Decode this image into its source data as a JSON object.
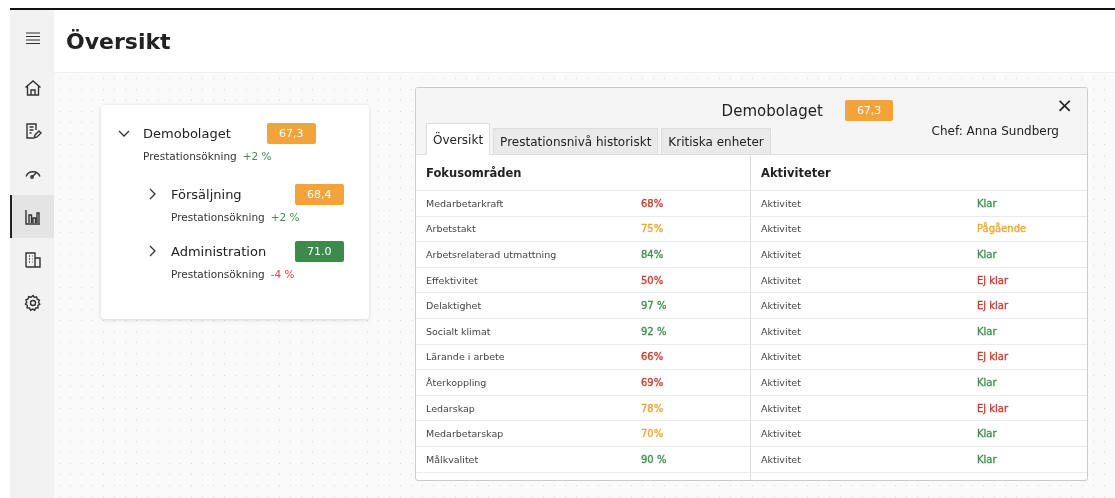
{
  "sidebar": {
    "items": [
      {
        "kind": "menu",
        "selected": false
      },
      {
        "kind": "home",
        "selected": false
      },
      {
        "kind": "report",
        "selected": false
      },
      {
        "kind": "gauge",
        "selected": false
      },
      {
        "kind": "chart",
        "selected": true
      },
      {
        "kind": "building",
        "selected": false
      },
      {
        "kind": "settings",
        "selected": false
      }
    ]
  },
  "page_title": "Översikt",
  "tree": [
    {
      "name": "Demobolaget",
      "score": {
        "text": "67,3",
        "color": "#f2a43a"
      },
      "metric": "Prestationsökning",
      "change": {
        "text": "+2 %",
        "color": "#3f8f4f"
      },
      "expanded": true,
      "children": [
        {
          "name": "Försäljning",
          "score": {
            "text": "68,4",
            "color": "#f2a43a"
          },
          "metric": "Prestationsökning",
          "change": {
            "text": "+2 %",
            "color": "#3f8f4f"
          },
          "expanded": false
        },
        {
          "name": "Administration",
          "score": {
            "text": "71.0",
            "color": "#3d8a4c"
          },
          "metric": "Prestationsökning",
          "change": {
            "text": "-4 %",
            "color": "#e0453a"
          },
          "expanded": false
        }
      ]
    }
  ],
  "panel": {
    "title": "Demobolaget",
    "score": {
      "text": "67,3",
      "color": "#f2a43a"
    },
    "manager": "Chef: Anna Sundberg",
    "close": "×",
    "tabs": [
      {
        "label": "Översikt",
        "selected": true
      },
      {
        "label": "Prestationsnivå historiskt",
        "selected": false
      },
      {
        "label": "Kritiska enheter",
        "selected": false
      }
    ],
    "columns": [
      "Fokusområden",
      "Aktiviteter"
    ],
    "rows": [
      {
        "area": "Medarbetarkraft",
        "value": {
          "text": "68%",
          "color": "#c8402f"
        },
        "activity": "Aktivitet",
        "status": {
          "text": "Klar",
          "color": "#3f8f4f"
        }
      },
      {
        "area": "Arbetstakt",
        "value": {
          "text": "75%",
          "color": "#f2a43a"
        },
        "activity": "Aktivitet",
        "status": {
          "text": "Pågående",
          "color": "#f2a43a"
        }
      },
      {
        "area": "Arbetsrelaterad utmattning",
        "value": {
          "text": "84%",
          "color": "#3f8f4f"
        },
        "activity": "Aktivitet",
        "status": {
          "text": "Klar",
          "color": "#3f8f4f"
        }
      },
      {
        "area": "Effektivitet",
        "value": {
          "text": "50%",
          "color": "#c8402f"
        },
        "activity": "Aktivitet",
        "status": {
          "text": "Ej klar",
          "color": "#c8402f"
        }
      },
      {
        "area": "Delaktighet",
        "value": {
          "text": "97 %",
          "color": "#3f8f4f"
        },
        "activity": "Aktivitet",
        "status": {
          "text": "Ej klar",
          "color": "#c8402f"
        }
      },
      {
        "area": "Socialt klimat",
        "value": {
          "text": "92 %",
          "color": "#3f8f4f"
        },
        "activity": "Aktivitet",
        "status": {
          "text": "Klar",
          "color": "#3f8f4f"
        }
      },
      {
        "area": "Lärande i arbete",
        "value": {
          "text": "66%",
          "color": "#c8402f"
        },
        "activity": "Aktivitet",
        "status": {
          "text": "Ej klar",
          "color": "#c8402f"
        }
      },
      {
        "area": "Återkoppling",
        "value": {
          "text": "69%",
          "color": "#c8402f"
        },
        "activity": "Aktivitet",
        "status": {
          "text": "Klar",
          "color": "#3f8f4f"
        }
      },
      {
        "area": "Ledarskap",
        "value": {
          "text": "78%",
          "color": "#f2a43a"
        },
        "activity": "Aktivitet",
        "status": {
          "text": "Ej klar",
          "color": "#c8402f"
        }
      },
      {
        "area": "Medarbetarskap",
        "value": {
          "text": "70%",
          "color": "#f2a43a"
        },
        "activity": "Aktivitet",
        "status": {
          "text": "Klar",
          "color": "#3f8f4f"
        }
      },
      {
        "area": "Målkvalitet",
        "value": {
          "text": "90 %",
          "color": "#3f8f4f"
        },
        "activity": "Aktivitet",
        "status": {
          "text": "Klar",
          "color": "#3f8f4f"
        }
      }
    ]
  }
}
